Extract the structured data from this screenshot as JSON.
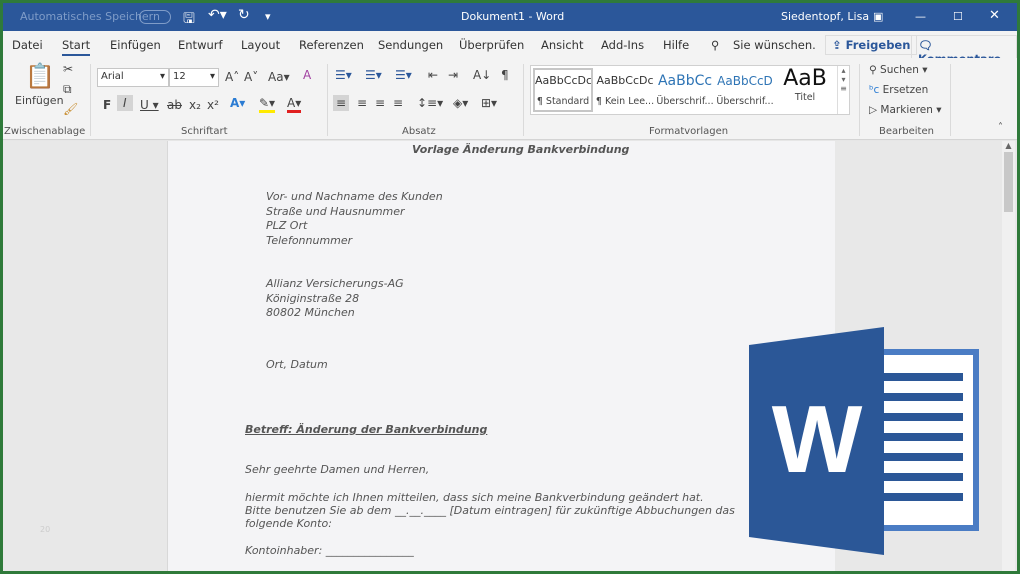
{
  "titlebar": {
    "autosave": "Automatisches Speichern",
    "title": "Dokument1 - Word",
    "user": "Siedentopf, Lisa"
  },
  "tabs": [
    "Datei",
    "Start",
    "Einfügen",
    "Entwurf",
    "Layout",
    "Referenzen",
    "Sendungen",
    "Überprüfen",
    "Ansicht",
    "Add-Ins",
    "Hilfe"
  ],
  "search_placeholder": "Sie wünschen.",
  "share": "Freigeben",
  "comments": "Kommentare",
  "ribbon": {
    "paste": "Einfügen",
    "font": "Arial",
    "size": "12",
    "groups": [
      "Zwischenablage",
      "Schriftart",
      "Absatz",
      "Formatvorlagen",
      "Bearbeiten"
    ],
    "styles": [
      {
        "preview": "AaBbCcDc",
        "name": "¶ Standard"
      },
      {
        "preview": "AaBbCcDc",
        "name": "¶ Kein Lee..."
      },
      {
        "preview": "AaBbCc",
        "name": "Überschrif..."
      },
      {
        "preview": "AaBbCcD",
        "name": "Überschrif..."
      },
      {
        "preview": "AaB",
        "name": "Titel"
      }
    ],
    "edit": [
      "Suchen",
      "Ersetzen",
      "Markieren"
    ]
  },
  "document": {
    "heading": "Vorlage Änderung Bankverbindung",
    "sender": [
      "Vor- und Nachname des Kunden",
      "Straße und Hausnummer",
      "PLZ Ort",
      "Telefonnummer"
    ],
    "recipient": [
      "Allianz Versicherungs-AG",
      "Königinstraße 28",
      "80802 München"
    ],
    "place_date": "Ort, Datum",
    "subject": "Betreff: Änderung der Bankverbindung",
    "greeting": "Sehr geehrte Damen und Herren,",
    "body": [
      "hiermit möchte ich Ihnen mitteilen, dass sich meine Bankverbindung geändert hat.",
      "Bitte benutzen Sie ab dem __.__.____ [Datum eintragen] für zukünftige Abbuchungen das",
      "folgende Konto:"
    ],
    "account_holder": "Kontoinhaber: ________________",
    "line_number": "20"
  },
  "colors": {
    "word_blue": "#2b579a",
    "frame_green": "#2f7a3a",
    "logo_dark": "#2b5797",
    "logo_light": "#4a7cc4"
  }
}
